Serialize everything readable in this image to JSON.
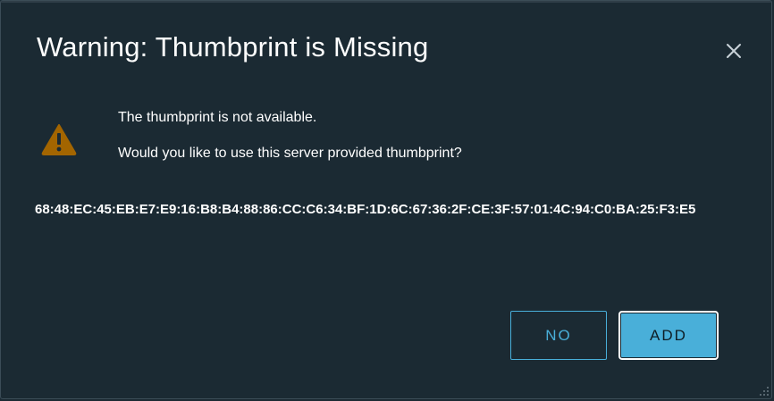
{
  "dialog": {
    "title": "Warning: Thumbprint is Missing",
    "close_icon": "close-icon",
    "warning_icon": "warning-triangle-icon",
    "message_line1": "The thumbprint is not available.",
    "message_line2": "Would you like to use this server provided thumbprint?",
    "thumbprint": "68:48:EC:45:EB:E7:E9:16:B8:B4:88:86:CC:C6:34:BF:1D:6C:67:36:2F:CE:3F:57:01:4C:94:C0:BA:25:F3:E5",
    "no_label": "NO",
    "add_label": "ADD"
  },
  "colors": {
    "background": "#1b2a33",
    "accent": "#49afd9",
    "warning": "#a36500",
    "text": "#ffffff"
  }
}
